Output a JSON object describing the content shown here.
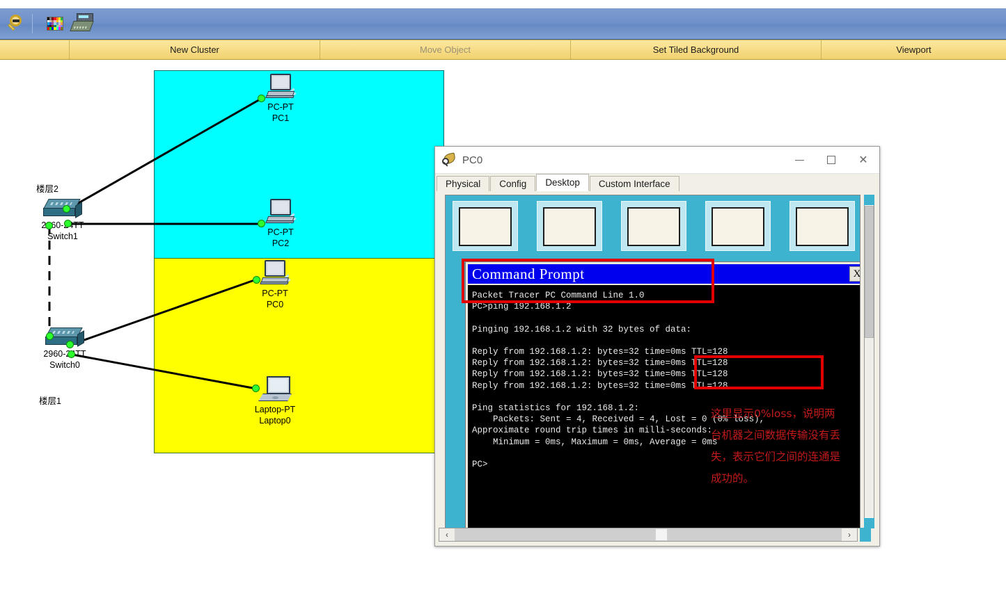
{
  "toolbar": {
    "zoom_out_icon": "magnifier-zoom-out-icon",
    "palette_icon": "color-palette-icon",
    "device_icon": "switch-device-icon"
  },
  "menubar": {
    "items": [
      {
        "label": "New Cluster",
        "disabled": false
      },
      {
        "label": "Move Object",
        "disabled": true
      },
      {
        "label": "Set Tiled Background",
        "disabled": false
      },
      {
        "label": "Viewport",
        "disabled": false
      }
    ]
  },
  "workspace": {
    "floor_labels": [
      {
        "text": "楼层2"
      },
      {
        "text": "楼层1"
      }
    ],
    "devices": [
      {
        "model": "PC-PT",
        "name": "PC1"
      },
      {
        "model": "PC-PT",
        "name": "PC2"
      },
      {
        "model": "PC-PT",
        "name": "PC0"
      },
      {
        "model": "Laptop-PT",
        "name": "Laptop0"
      },
      {
        "model": "2960-24TT",
        "name": "Switch1"
      },
      {
        "model": "2960-24TT",
        "name": "Switch0"
      }
    ]
  },
  "device_window": {
    "title": "PC0",
    "icon": "packet-tracer-icon",
    "minimize_label": "—",
    "maximize_label": "□",
    "close_label": "✕",
    "tabs": [
      {
        "label": "Physical",
        "active": false
      },
      {
        "label": "Config",
        "active": false
      },
      {
        "label": "Desktop",
        "active": true
      },
      {
        "label": "Custom Interface",
        "active": false
      }
    ]
  },
  "command_prompt": {
    "title": "Command Prompt",
    "close_label": "X",
    "lines": [
      "Packet Tracer PC Command Line 1.0",
      "PC>ping 192.168.1.2",
      "",
      "Pinging 192.168.1.2 with 32 bytes of data:",
      "",
      "Reply from 192.168.1.2: bytes=32 time=0ms TTL=128",
      "Reply from 192.168.1.2: bytes=32 time=0ms TTL=128",
      "Reply from 192.168.1.2: bytes=32 time=0ms TTL=128",
      "Reply from 192.168.1.2: bytes=32 time=0ms TTL=128",
      "",
      "Ping statistics for 192.168.1.2:",
      "    Packets: Sent = 4, Received = 4, Lost = 0 (0% loss),",
      "Approximate round trip times in milli-seconds:",
      "    Minimum = 0ms, Maximum = 0ms, Average = 0ms",
      "",
      "PC>"
    ]
  },
  "annotation": {
    "color": "#c21a1a",
    "text": "这里显示0%loss，说明两台机器之间数据传输没有丢失，表示它们之间的连通是成功的。"
  },
  "scrollbars": {
    "v_up": "˄",
    "v_down": "˅",
    "h_left": "‹",
    "h_right": "›"
  }
}
